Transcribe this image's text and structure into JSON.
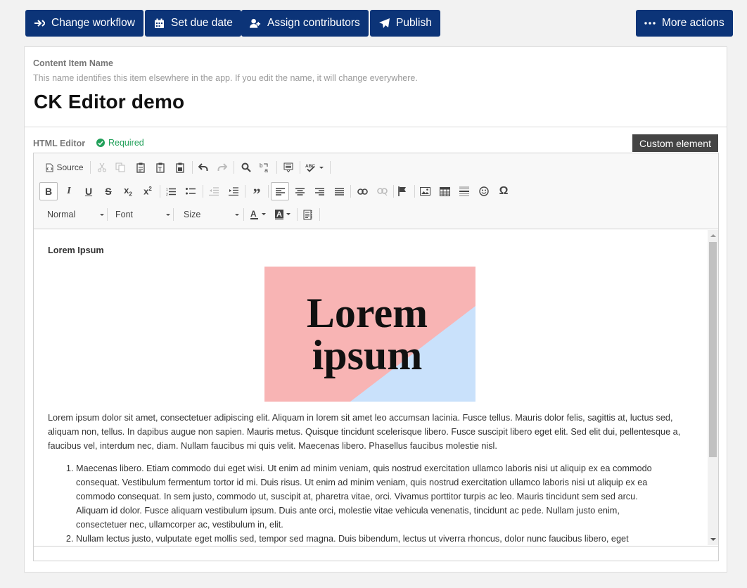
{
  "actions": {
    "change_workflow": "Change workflow",
    "set_due_date": "Set due date",
    "assign_contributors": "Assign contributors",
    "publish": "Publish",
    "more_actions": "More actions"
  },
  "name_section": {
    "label": "Content Item Name",
    "help": "This name identifies this item elsewhere in the app. If you edit the name, it will change everywhere.",
    "value": "CK Editor demo"
  },
  "editor_field": {
    "label": "HTML Editor",
    "required": "Required",
    "custom_element": "Custom element"
  },
  "toolbar": {
    "source": "Source",
    "format": "Normal",
    "font": "Font",
    "size": "Size"
  },
  "content": {
    "heading": "Lorem Ipsum",
    "image_text": [
      "Lorem",
      "ipsum"
    ],
    "paragraph": "Lorem ipsum dolor sit amet, consectetuer adipiscing elit. Aliquam in lorem sit amet leo accumsan lacinia. Fusce tellus. Mauris dolor felis, sagittis at, luctus sed, aliquam non, tellus. In dapibus augue non sapien. Mauris metus. Quisque tincidunt scelerisque libero. Fusce suscipit libero eget elit. Sed elit dui, pellentesque a, faucibus vel, interdum nec, diam. Nullam faucibus mi quis velit. Maecenas libero. Phasellus faucibus molestie nisl.",
    "list": [
      "Maecenas libero. Etiam commodo dui eget wisi. Ut enim ad minim veniam, quis nostrud exercitation ullamco laboris nisi ut aliquip ex ea commodo consequat. Vestibulum fermentum tortor id mi. Duis risus. Ut enim ad minim veniam, quis nostrud exercitation ullamco laboris nisi ut aliquip ex ea commodo consequat. In sem justo, commodo ut, suscipit at, pharetra vitae, orci. Vivamus porttitor turpis ac leo. Mauris tincidunt sem sed arcu. Aliquam id dolor. Fusce aliquam vestibulum ipsum. Duis ante orci, molestie vitae vehicula venenatis, tincidunt ac pede. Nullam justo enim, consectetuer nec, ullamcorper ac, vestibulum in, elit.",
      "Nullam lectus justo, vulputate eget mollis sed, tempor sed magna. Duis bibendum, lectus ut viverra rhoncus, dolor nunc faucibus libero, eget"
    ]
  },
  "colors": {
    "primary_button": "#0c3478",
    "required_green": "#22a05a",
    "image_pink": "#f8b4b4",
    "image_blue": "#c9e1fb"
  }
}
